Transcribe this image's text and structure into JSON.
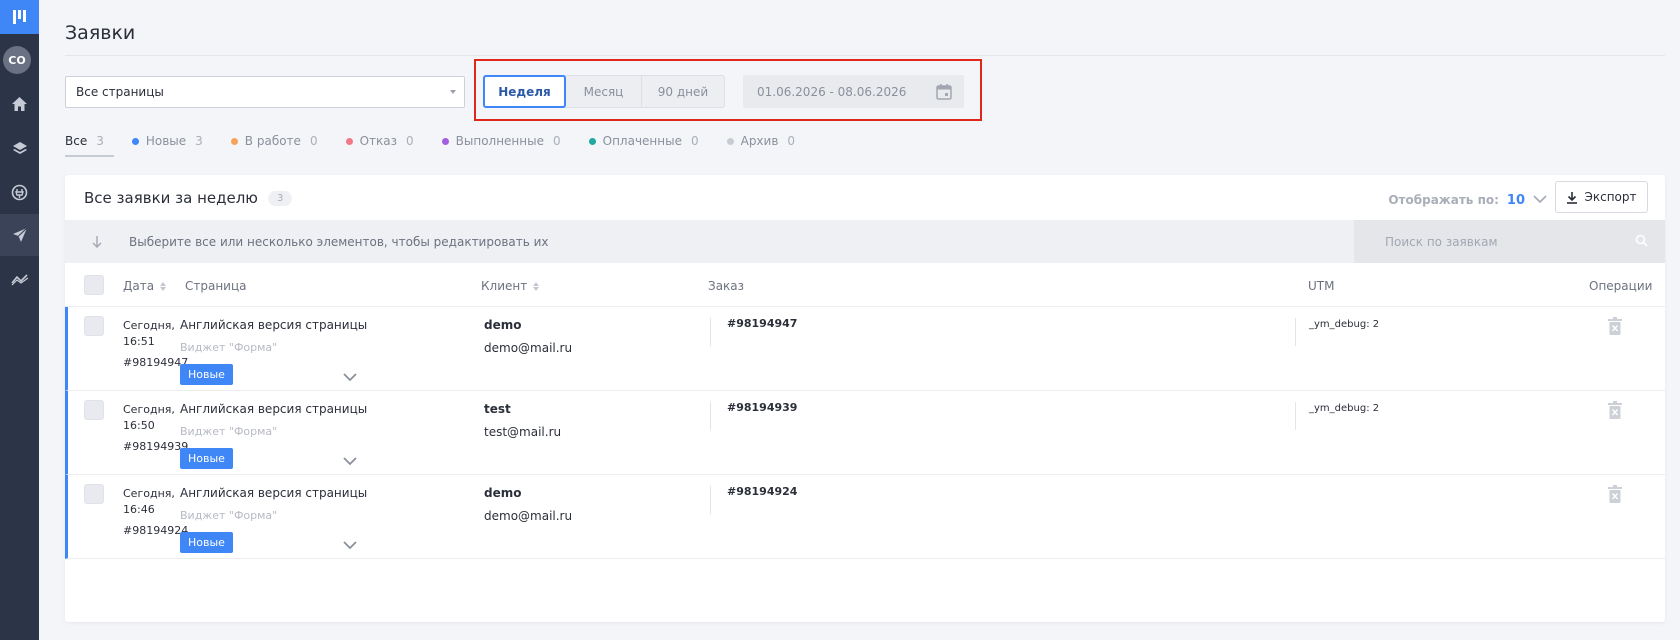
{
  "sidebar": {
    "avatar": "CO",
    "icons": [
      "home-icon",
      "layers-icon",
      "plugin-icon",
      "send-icon",
      "analytics-icon"
    ]
  },
  "page": {
    "title": "Заявки"
  },
  "filters": {
    "page_select": "Все страницы",
    "periods": [
      {
        "label": "Неделя",
        "active": true
      },
      {
        "label": "Месяц",
        "active": false
      },
      {
        "label": "90 дней",
        "active": false
      }
    ],
    "date_range": "01.06.2026 - 08.06.2026"
  },
  "status_tabs": [
    {
      "label": "Все",
      "count": "3",
      "color": "",
      "active": true
    },
    {
      "label": "Новые",
      "count": "3",
      "color": "#3f86f7"
    },
    {
      "label": "В работе",
      "count": "0",
      "color": "#f5a35c"
    },
    {
      "label": "Отказ",
      "count": "0",
      "color": "#f27a86"
    },
    {
      "label": "Выполненные",
      "count": "0",
      "color": "#a35ee0"
    },
    {
      "label": "Оплаченные",
      "count": "0",
      "color": "#1fa8a0"
    },
    {
      "label": "Архив",
      "count": "0",
      "color": "#c7cbd3"
    }
  ],
  "card": {
    "title": "Все заявки за неделю",
    "count": "3",
    "display_label": "Отображать по:",
    "display_value": "10",
    "export_label": "Экспорт",
    "bulk_text": "Выберите все или несколько элементов, чтобы редактировать их",
    "search_placeholder": "Поиск по заявкам"
  },
  "table": {
    "headers": {
      "date": "Дата",
      "page": "Страница",
      "client": "Клиент",
      "order": "Заказ",
      "utm": "UTM",
      "ops": "Операции"
    },
    "rows": [
      {
        "date": "Сегодня, 16:51",
        "id": "#98194947",
        "page": "Английская версия страницы",
        "widget": "Виджет \"Форма\"",
        "status": "Новые",
        "client_name": "demo",
        "client_email": "demo@mail.ru",
        "order": "#98194947",
        "utm": "_ym_debug: 2"
      },
      {
        "date": "Сегодня, 16:50",
        "id": "#98194939",
        "page": "Английская версия страницы",
        "widget": "Виджет \"Форма\"",
        "status": "Новые",
        "client_name": "test",
        "client_email": "test@mail.ru",
        "order": "#98194939",
        "utm": "_ym_debug: 2"
      },
      {
        "date": "Сегодня, 16:46",
        "id": "#98194924",
        "page": "Английская версия страницы",
        "widget": "Виджет \"Форма\"",
        "status": "Новые",
        "client_name": "demo",
        "client_email": "demo@mail.ru",
        "order": "#98194924",
        "utm": ""
      }
    ]
  },
  "colors": {
    "accent": "#3f86f7",
    "sidebar": "#2c3447",
    "highlight": "#e0271c"
  }
}
